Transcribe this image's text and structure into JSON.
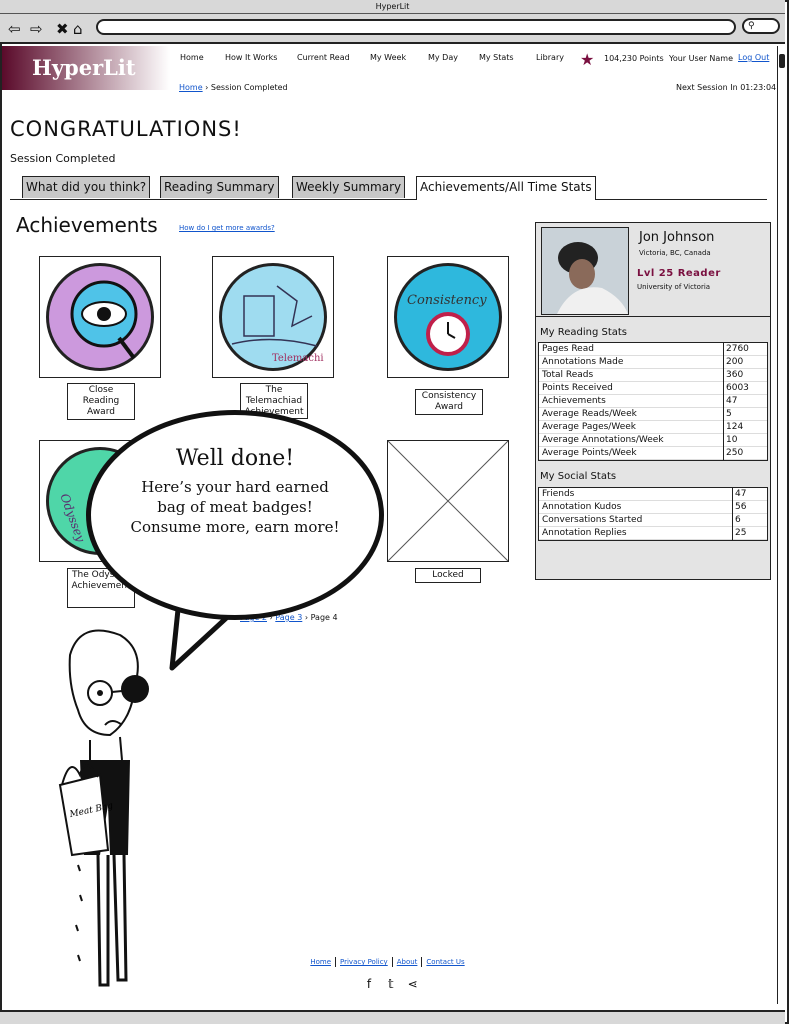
{
  "browser": {
    "title": "HyperLit"
  },
  "header": {
    "logo": "HyperLit",
    "nav": [
      {
        "label": "Home"
      },
      {
        "label": "How It Works"
      },
      {
        "label": "Current Read"
      },
      {
        "label": "My Week"
      },
      {
        "label": "My Day"
      },
      {
        "label": "My Stats"
      },
      {
        "label": "Library"
      }
    ],
    "points": "104,230 Points",
    "username": "Your User Name",
    "logout": "Log Out"
  },
  "breadcrumb": {
    "home": "Home",
    "current": "Session Completed"
  },
  "next_session": "Next Session In 01:23:04",
  "page": {
    "title": "CONGRATULATIONS!",
    "subtitle": "Session Completed"
  },
  "tabs": [
    {
      "label": "What did you think?"
    },
    {
      "label": "Reading Summary"
    },
    {
      "label": "Weekly Summary"
    },
    {
      "label": "Achievements/All Time Stats"
    }
  ],
  "achievements": {
    "title": "Achievements",
    "help_link": "How do I get more awards?",
    "badges": [
      {
        "label": "Close Reading Award",
        "art": "Close Reading"
      },
      {
        "label": "The Telemachiad Achievement",
        "art": "Telemachiad"
      },
      {
        "label": "Consistency Award",
        "art": "Consistency"
      },
      {
        "label": "The Odyssey Achievement",
        "art": "Odyssey"
      },
      {
        "label": "Locked"
      }
    ],
    "pager": {
      "p2": "Page 2",
      "p3": "Page 3",
      "p4": "Page 4"
    }
  },
  "profile": {
    "name": "Jon Johnson",
    "location": "Victoria, BC, Canada",
    "level": "Lvl 25 Reader",
    "university": "University of Victoria",
    "reading_title": "My Reading Stats",
    "reading": [
      {
        "k": "Pages Read",
        "v": "2760"
      },
      {
        "k": "Annotations Made",
        "v": "200"
      },
      {
        "k": "Total Reads",
        "v": "360"
      },
      {
        "k": "Points Received",
        "v": "6003"
      },
      {
        "k": "Achievements",
        "v": "47"
      },
      {
        "k": "Average Reads/Week",
        "v": "5"
      },
      {
        "k": "Average Pages/Week",
        "v": "124"
      },
      {
        "k": "Average Annotations/Week",
        "v": "10"
      },
      {
        "k": "Average Points/Week",
        "v": "250"
      }
    ],
    "social_title": "My Social Stats",
    "social": [
      {
        "k": "Friends",
        "v": "47"
      },
      {
        "k": "Annotation Kudos",
        "v": "56"
      },
      {
        "k": "Conversations Started",
        "v": "6"
      },
      {
        "k": "Annotation Replies",
        "v": "25"
      }
    ]
  },
  "speech": {
    "line1": "Well done!",
    "line2": "Here’s your hard earned",
    "line3": "bag of meat badges!",
    "line4": "Consume more, earn more!",
    "bag_text": "Meat Bag"
  },
  "footer": {
    "home": "Home",
    "privacy": "Privacy Policy",
    "about": "About",
    "contact": "Contact Us"
  },
  "colors": {
    "brand": "#5a0a2a",
    "level": "#7a1040",
    "link": "#1155cc"
  }
}
